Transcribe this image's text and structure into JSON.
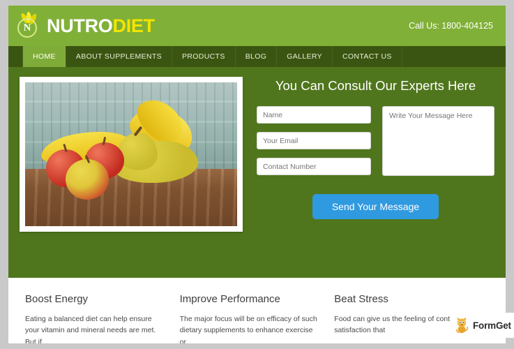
{
  "site": {
    "header": {
      "brand": {
        "name_part1": "NUTRO",
        "name_part2": "DIET",
        "mark_letter": "N",
        "mark_icon": "wheat-leaf-icon"
      },
      "call_us": "Call Us: 1800-404125",
      "bg_color": "#80b038"
    },
    "nav": {
      "bg_color": "#3a5511",
      "active_color": "#7fac39",
      "items": [
        {
          "label": "HOME",
          "active": true
        },
        {
          "label": "ABOUT SUPPLEMENTS",
          "active": false
        },
        {
          "label": "PRODUCTS",
          "active": false
        },
        {
          "label": "BLOG",
          "active": false
        },
        {
          "label": "GALLERY",
          "active": false
        },
        {
          "label": "CONTACT US",
          "active": false
        }
      ]
    },
    "hero": {
      "bg_color": "#50761d",
      "image_alt": "fresh-fruit-photo",
      "form": {
        "title": "You Can Consult Our Experts Here",
        "name_placeholder": "Name",
        "email_placeholder": "Your Email",
        "phone_placeholder": "Contact Number",
        "message_placeholder": "Write Your Message Here",
        "name_value": "",
        "email_value": "",
        "phone_value": "",
        "message_value": "",
        "submit_label": "Send Your Message",
        "submit_color": "#2f9ae0"
      }
    },
    "features": [
      {
        "title": "Boost Energy",
        "text": "Eating a balanced diet can help ensure your vitamin and mineral needs are met. But if"
      },
      {
        "title": "Improve Performance",
        "text": "The major focus will be on efficacy of such dietary supplements to enhance exercise or"
      },
      {
        "title": "Beat Stress",
        "text": "Food can give us the feeling of control and satisfaction that"
      }
    ],
    "watermark": {
      "label": "FormGet",
      "icon": "cat-mascot-icon"
    }
  }
}
